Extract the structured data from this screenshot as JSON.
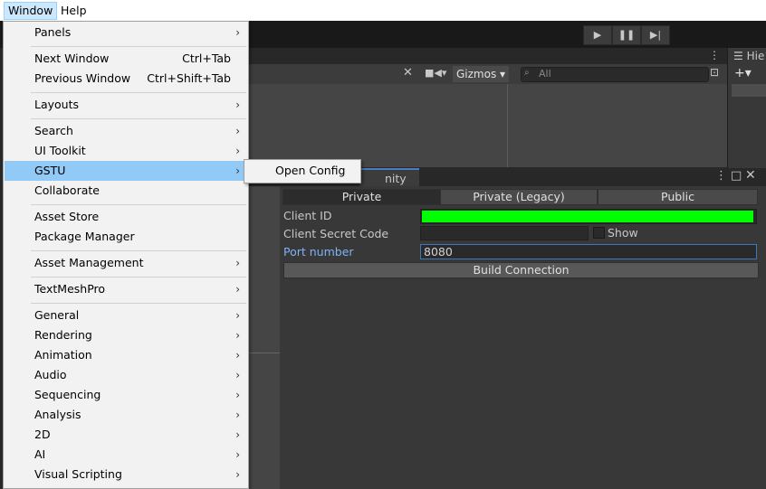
{
  "menubar": {
    "window": "Window",
    "help": "Help"
  },
  "menu": {
    "items": [
      {
        "label": "Panels",
        "shortcut": "",
        "submenu": true
      },
      {
        "label": "Next Window",
        "shortcut": "Ctrl+Tab",
        "submenu": false
      },
      {
        "label": "Previous Window",
        "shortcut": "Ctrl+Shift+Tab",
        "submenu": false
      },
      {
        "label": "Layouts",
        "shortcut": "",
        "submenu": true
      },
      {
        "label": "Search",
        "shortcut": "",
        "submenu": true
      },
      {
        "label": "UI Toolkit",
        "shortcut": "",
        "submenu": true
      },
      {
        "label": "GSTU",
        "shortcut": "",
        "submenu": true
      },
      {
        "label": "Collaborate",
        "shortcut": "",
        "submenu": false
      },
      {
        "label": "Asset Store",
        "shortcut": "",
        "submenu": false
      },
      {
        "label": "Package Manager",
        "shortcut": "",
        "submenu": false
      },
      {
        "label": "Asset Management",
        "shortcut": "",
        "submenu": true
      },
      {
        "label": "TextMeshPro",
        "shortcut": "",
        "submenu": true
      },
      {
        "label": "General",
        "shortcut": "",
        "submenu": true
      },
      {
        "label": "Rendering",
        "shortcut": "",
        "submenu": true
      },
      {
        "label": "Animation",
        "shortcut": "",
        "submenu": true
      },
      {
        "label": "Audio",
        "shortcut": "",
        "submenu": true
      },
      {
        "label": "Sequencing",
        "shortcut": "",
        "submenu": true
      },
      {
        "label": "Analysis",
        "shortcut": "",
        "submenu": true
      },
      {
        "label": "2D",
        "shortcut": "",
        "submenu": true
      },
      {
        "label": "AI",
        "shortcut": "",
        "submenu": true
      },
      {
        "label": "Visual Scripting",
        "shortcut": "",
        "submenu": true
      }
    ],
    "arrow": "›"
  },
  "submenu": {
    "open_config": "Open Config"
  },
  "scene_toolbar": {
    "gizmos": "Gizmos",
    "search_placeholder": "All"
  },
  "hierarchy": {
    "tab": "Hie"
  },
  "gstu": {
    "tab_title": "nity",
    "tabs": [
      "Private",
      "Private (Legacy)",
      "Public"
    ],
    "client_id_label": "Client ID",
    "client_secret_label": "Client Secret Code",
    "show_label": "Show",
    "port_label": "Port number",
    "port_value": "8080",
    "build_button": "Build Connection"
  },
  "colors": {
    "menu_highlight": "#91c9f7",
    "client_id_fill": "#00ff00",
    "port_label": "#7fb3f5"
  }
}
